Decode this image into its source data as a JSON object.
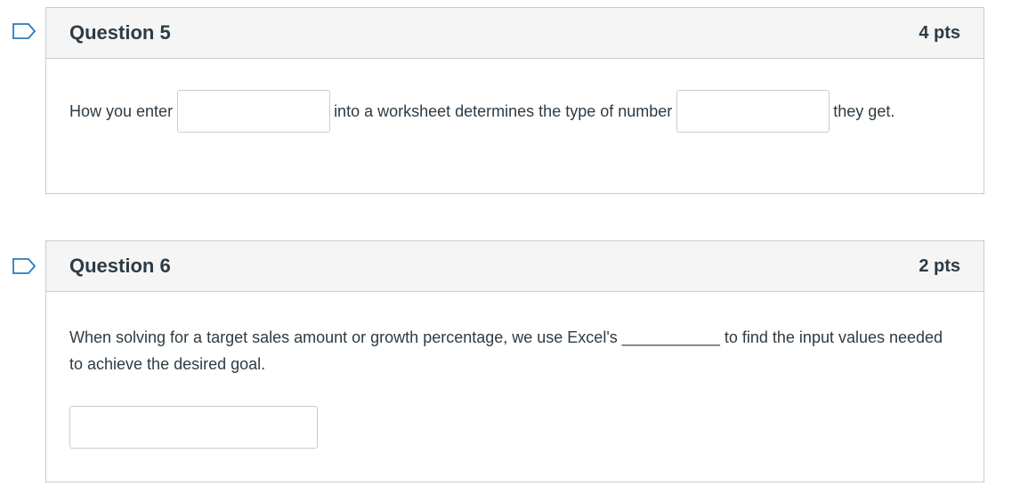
{
  "questions": [
    {
      "title": "Question 5",
      "points": "4 pts",
      "text_before": "How you enter",
      "text_middle": "into a worksheet determines the type of number",
      "text_after": "they get.",
      "blank1_value": "",
      "blank2_value": ""
    },
    {
      "title": "Question 6",
      "points": "2 pts",
      "text": "When solving for a target sales amount or growth percentage, we use Excel's ___________ to find the input values needed to achieve the desired goal.",
      "answer_value": ""
    }
  ],
  "colors": {
    "border": "#c7cdd1",
    "header_bg": "#f5f5f5",
    "text": "#2d3b45",
    "flag_stroke": "#2b7abc"
  },
  "icons": {
    "flag": "flag-question-icon"
  }
}
